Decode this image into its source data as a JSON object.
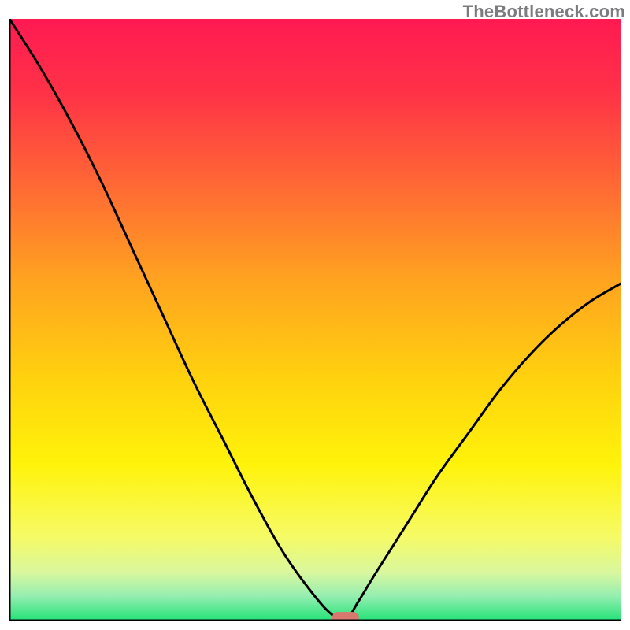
{
  "attribution": "TheBottleneck.com",
  "chart_data": {
    "type": "line",
    "title": "",
    "xlabel": "",
    "ylabel": "",
    "xlim": [
      0,
      100
    ],
    "ylim": [
      0,
      100
    ],
    "grid": false,
    "legend": false,
    "series": [
      {
        "name": "bottleneck-curve",
        "x": [
          0,
          5,
          10,
          15,
          20,
          25,
          30,
          35,
          40,
          45,
          50,
          53,
          55,
          57,
          60,
          65,
          70,
          75,
          80,
          85,
          90,
          95,
          100
        ],
        "y": [
          100,
          92,
          83,
          73,
          62,
          51,
          40,
          30,
          20,
          11,
          4,
          0.8,
          0,
          3,
          8,
          16,
          24,
          31,
          38,
          44,
          49,
          53,
          56
        ]
      }
    ],
    "markers": [
      {
        "name": "optimum-marker",
        "x": 55,
        "y": 0.5,
        "color": "#d9786f",
        "shape": "pill"
      }
    ],
    "background_gradient": {
      "stops": [
        {
          "offset": 0.0,
          "color": "#ff1a52"
        },
        {
          "offset": 0.12,
          "color": "#ff3147"
        },
        {
          "offset": 0.28,
          "color": "#ff6a34"
        },
        {
          "offset": 0.44,
          "color": "#ffa51f"
        },
        {
          "offset": 0.6,
          "color": "#ffd20e"
        },
        {
          "offset": 0.74,
          "color": "#fff30a"
        },
        {
          "offset": 0.86,
          "color": "#f6fb65"
        },
        {
          "offset": 0.92,
          "color": "#d9f79e"
        },
        {
          "offset": 0.96,
          "color": "#93eeb0"
        },
        {
          "offset": 1.0,
          "color": "#24e277"
        }
      ]
    },
    "axes": {
      "color": "#000000",
      "width": 3
    }
  }
}
